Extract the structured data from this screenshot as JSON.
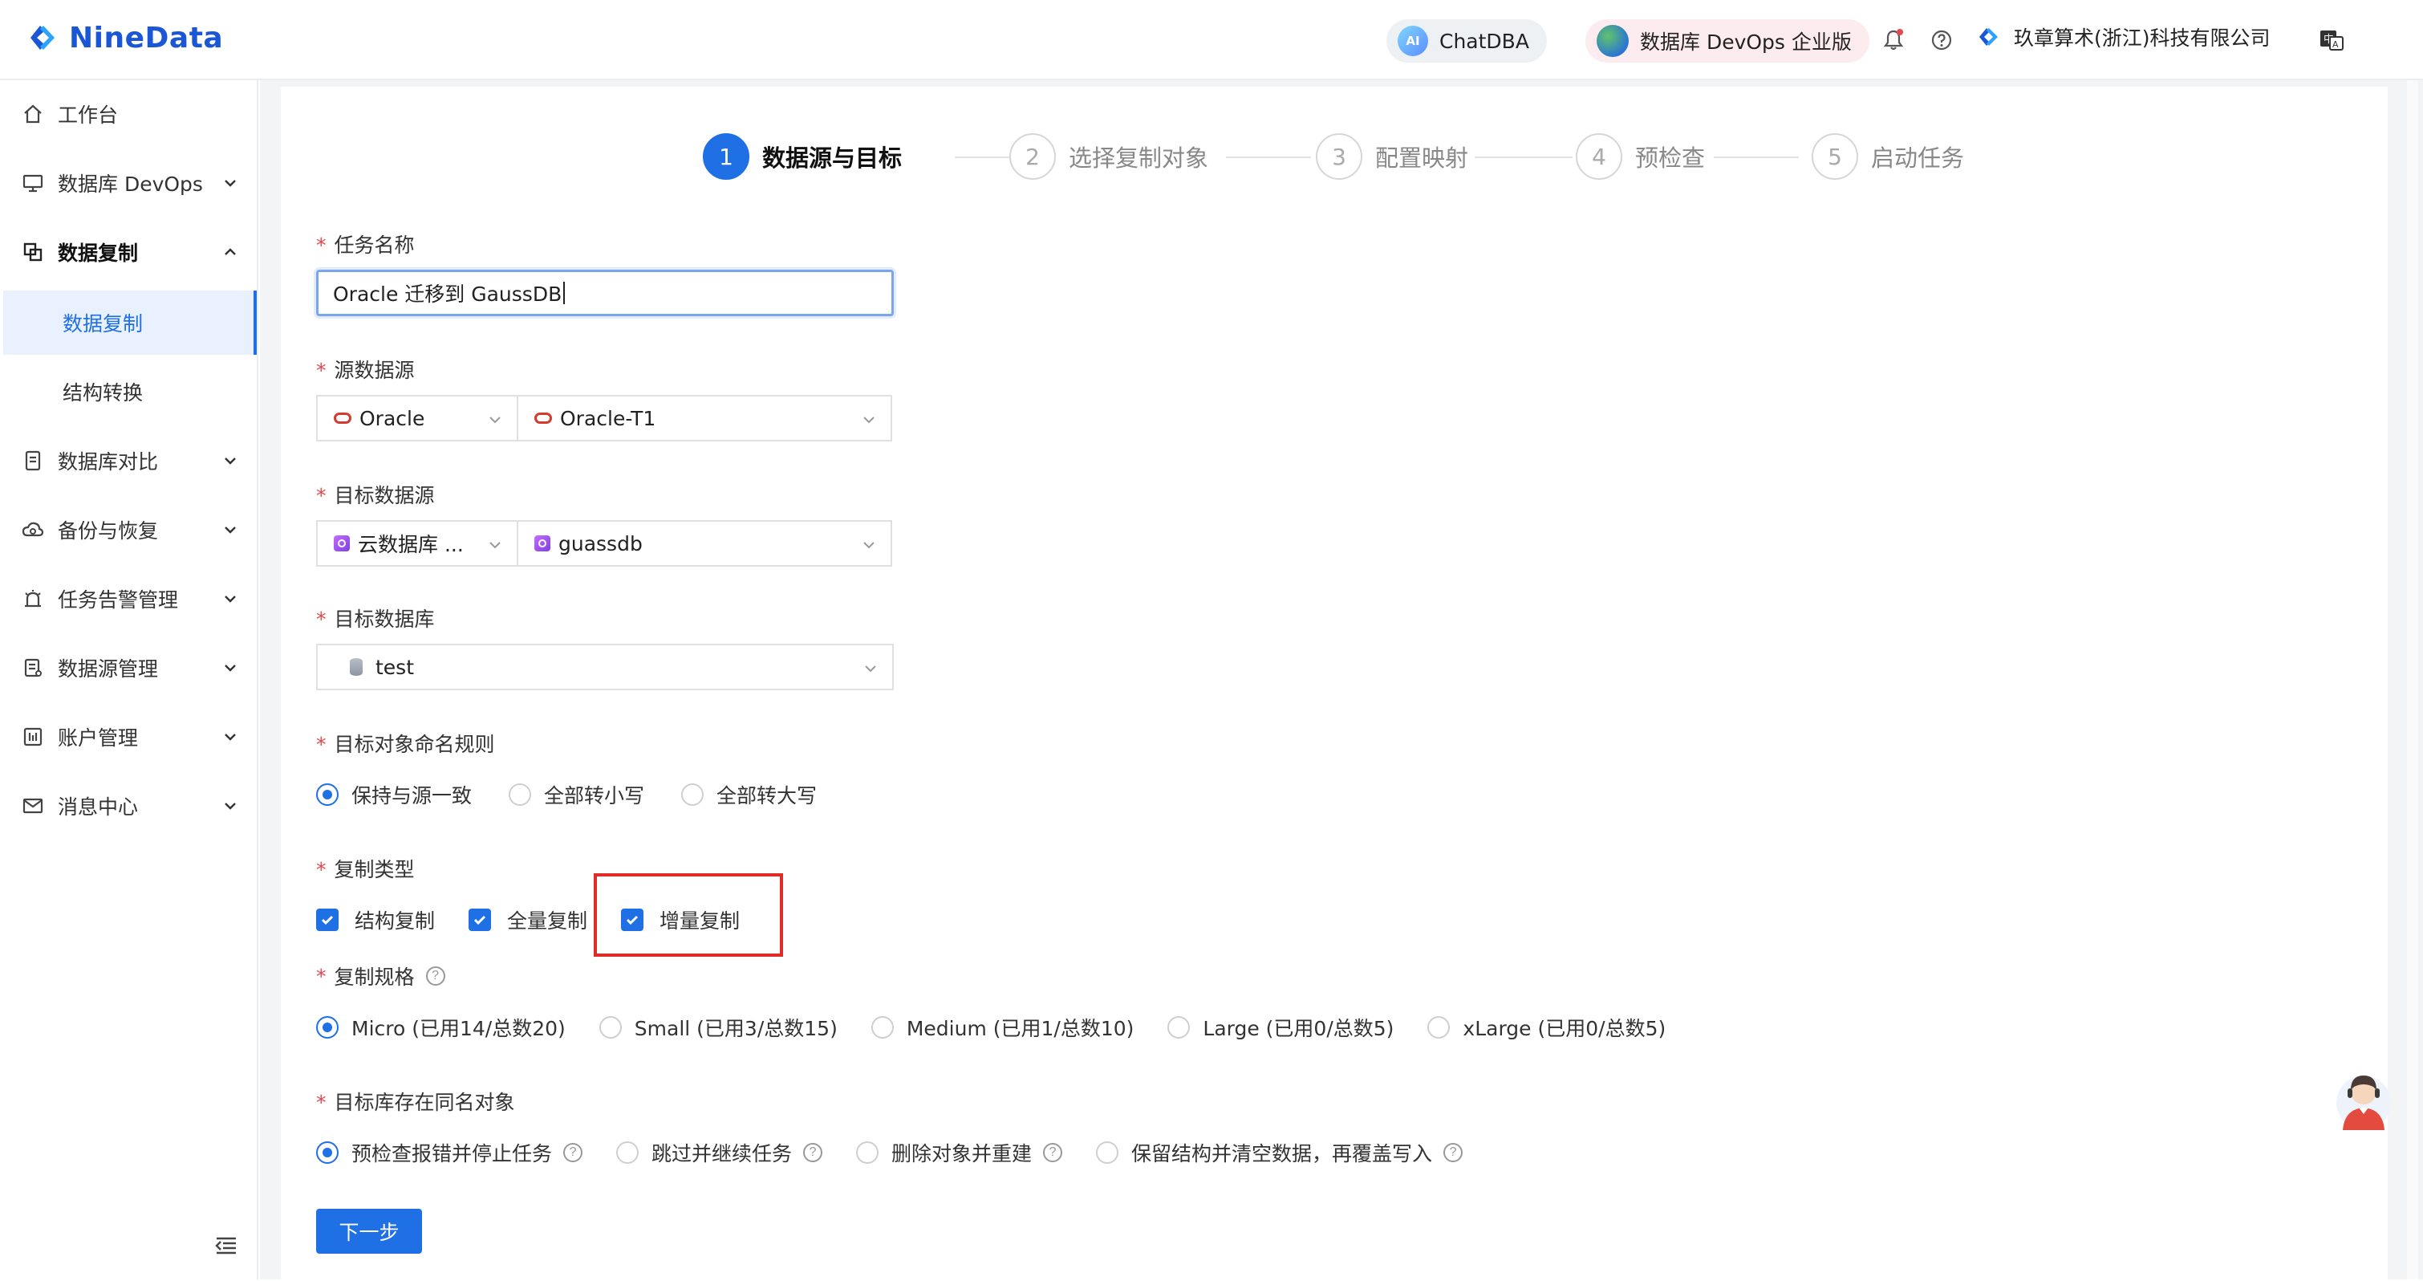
{
  "header": {
    "logo_text": "NineData",
    "chatdba_label": "ChatDBA",
    "ai_badge": "AI",
    "devops_label": "数据库 DevOps 企业版",
    "org_name": "玖章算术(浙江)科技有限公司"
  },
  "sidebar": {
    "items": [
      {
        "label": "工作台",
        "icon": "home-icon"
      },
      {
        "label": "数据库 DevOps",
        "icon": "monitor-icon"
      },
      {
        "label": "数据复制",
        "icon": "copy-icon"
      },
      {
        "label": "数据复制",
        "icon": ""
      },
      {
        "label": "结构转换",
        "icon": ""
      },
      {
        "label": "数据库对比",
        "icon": "compare-icon"
      },
      {
        "label": "备份与恢复",
        "icon": "cloud-icon"
      },
      {
        "label": "任务告警管理",
        "icon": "alarm-icon"
      },
      {
        "label": "数据源管理",
        "icon": "datasource-icon"
      },
      {
        "label": "账户管理",
        "icon": "account-icon"
      },
      {
        "label": "消息中心",
        "icon": "mail-icon"
      }
    ]
  },
  "steps": [
    {
      "num": "1",
      "label": "数据源与目标"
    },
    {
      "num": "2",
      "label": "选择复制对象"
    },
    {
      "num": "3",
      "label": "配置映射"
    },
    {
      "num": "4",
      "label": "预检查"
    },
    {
      "num": "5",
      "label": "启动任务"
    }
  ],
  "form": {
    "required_mark": "*",
    "task_name_label": "任务名称",
    "task_name_value": "Oracle 迁移到 GaussDB",
    "source_label": "源数据源",
    "source_type": "Oracle",
    "source_instance": "Oracle-T1",
    "target_label": "目标数据源",
    "target_type": "云数据库 ...",
    "target_instance": "guassdb",
    "target_db_label": "目标数据库",
    "target_db_value": "test",
    "naming_label": "目标对象命名规则",
    "naming_options": [
      "保持与源一致",
      "全部转小写",
      "全部转大写"
    ],
    "naming_selected": 0,
    "copy_type_label": "复制类型",
    "copy_types": [
      "结构复制",
      "全量复制",
      "增量复制"
    ],
    "spec_label": "复制规格",
    "spec_options": [
      "Micro (已用14/总数20)",
      "Small (已用3/总数15)",
      "Medium (已用1/总数10)",
      "Large (已用0/总数5)",
      "xLarge (已用0/总数5)"
    ],
    "spec_selected": 0,
    "conflict_label": "目标库存在同名对象",
    "conflict_options": [
      "预检查报错并停止任务",
      "跳过并继续任务",
      "删除对象并重建",
      "保留结构并清空数据，再覆盖写入"
    ],
    "conflict_selected": 0,
    "help_glyph": "?",
    "next_button": "下一步"
  },
  "colors": {
    "primary": "#1f6fe5",
    "highlight": "#e02b27",
    "brand": "#1a56d6"
  }
}
